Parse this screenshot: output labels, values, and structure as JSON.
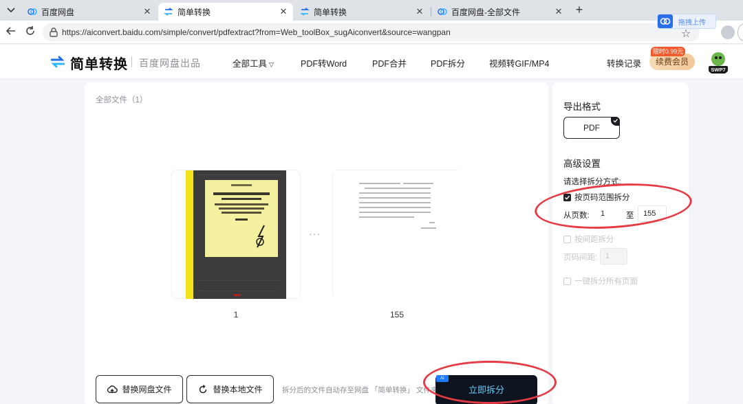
{
  "browser": {
    "tabs": [
      {
        "title": "百度网盘",
        "active": false
      },
      {
        "title": "简单转换",
        "active": true
      },
      {
        "title": "简单转换",
        "active": false
      },
      {
        "title": "百度网盘-全部文件",
        "active": false
      }
    ],
    "url": "https://aiconvert.baidu.com/simple/convert/pdfextract?from=Web_toolBox_sugAiconvert&source=wangpan",
    "extension_badge": "拖拽上传"
  },
  "header": {
    "logo_text": "简单转换",
    "logo_sub": "百度网盘出品",
    "nav": {
      "all_tools": "全部工具",
      "pdf_to_word": "PDF转Word",
      "pdf_merge": "PDF合并",
      "pdf_split": "PDF拆分",
      "video_to_gif": "视频转GIF/MP4"
    },
    "history": "转换记录",
    "vip_tag": "限时0.99元",
    "vip_button": "续费会员",
    "avatar_text": "SWP7"
  },
  "main": {
    "file_count": "全部文件（1）",
    "pages": [
      {
        "label": "1"
      },
      {
        "label": "155"
      }
    ],
    "ellipsis": "···",
    "replace_netdisk": "替换网盘文件",
    "replace_local": "替换本地文件",
    "save_hint": "拆分后的文件自动存至网盘 「简单转换」 文件夹",
    "split_button": "立即拆分",
    "ai_tag": "AI"
  },
  "side": {
    "export_title": "导出格式",
    "format": "PDF",
    "advanced_title": "高级设置",
    "split_mode_label": "请选择拆分方式:",
    "opt_page_range": "按页码范围拆分",
    "from_label": "从页数:",
    "from_value": "1",
    "to_label": "至",
    "to_value": "155",
    "opt_interval": "按间距拆分",
    "interval_label": "页码间距:",
    "interval_value": "1",
    "opt_all_pages": "一键拆分所有页面"
  },
  "colors": {
    "annotation": "#e63a44",
    "split_button_bg": "#0d1420",
    "split_button_text": "#5fd0ff",
    "vip_tag": "#f25a2c"
  }
}
